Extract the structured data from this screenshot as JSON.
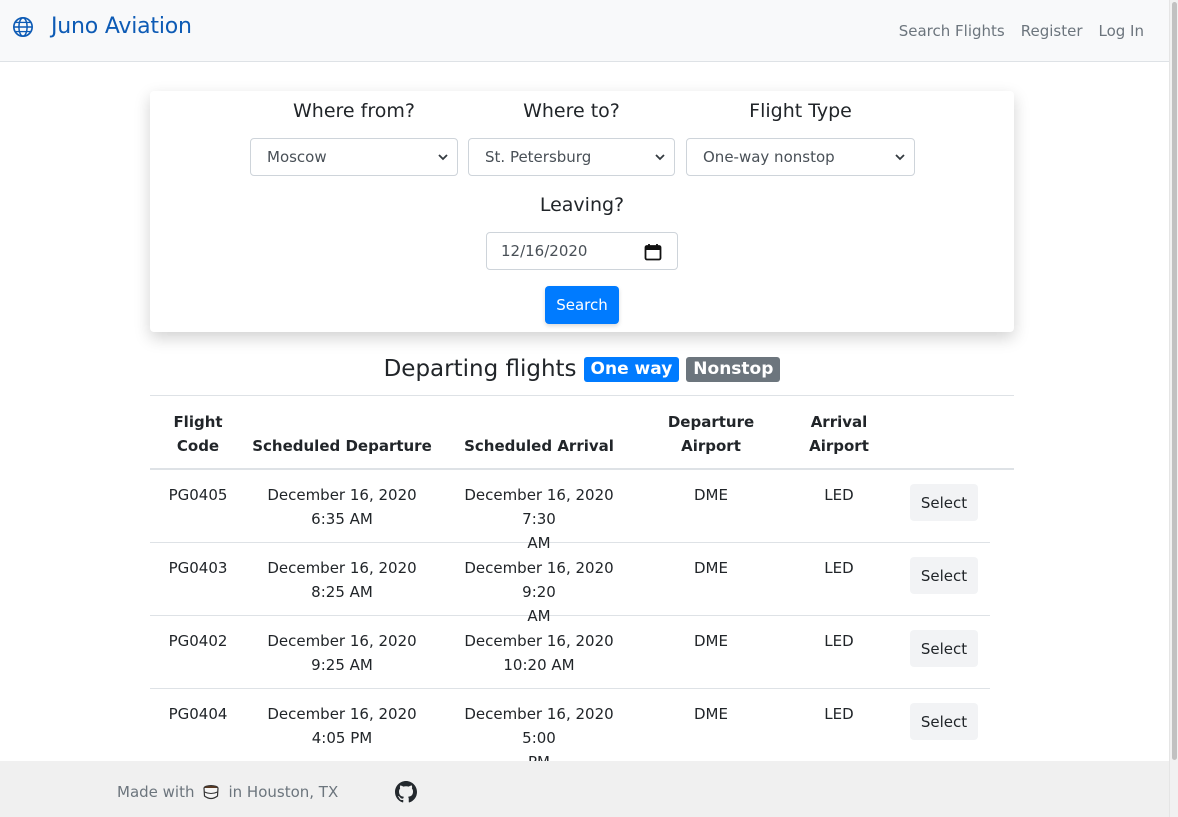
{
  "navbar": {
    "brand": "Juno Aviation",
    "links": [
      "Search Flights",
      "Register",
      "Log In"
    ]
  },
  "search": {
    "from_label": "Where from?",
    "from_value": "Moscow",
    "to_label": "Where to?",
    "to_value": "St. Petersburg",
    "type_label": "Flight Type",
    "type_value": "One-way nonstop",
    "leaving_label": "Leaving?",
    "leaving_value": "12/16/2020",
    "button": "Search"
  },
  "results": {
    "title": "Departing flights",
    "badges": [
      "One way",
      "Nonstop"
    ],
    "columns": {
      "code": [
        "Flight",
        "Code"
      ],
      "departure": "Scheduled Departure",
      "arrival": "Scheduled Arrival",
      "dep_airport": [
        "Departure",
        "Airport"
      ],
      "arr_airport": [
        "Arrival",
        "Airport"
      ]
    },
    "select_label": "Select",
    "rows": [
      {
        "code": "PG0405",
        "departure": [
          "December 16, 2020",
          "6:35 AM"
        ],
        "arrival": [
          "December 16, 2020 7:30",
          "AM"
        ],
        "from": "DME",
        "to": "LED"
      },
      {
        "code": "PG0403",
        "departure": [
          "December 16, 2020",
          "8:25 AM"
        ],
        "arrival": [
          "December 16, 2020 9:20",
          "AM"
        ],
        "from": "DME",
        "to": "LED"
      },
      {
        "code": "PG0402",
        "departure": [
          "December 16, 2020",
          "9:25 AM"
        ],
        "arrival": [
          "December 16, 2020",
          "10:20 AM"
        ],
        "from": "DME",
        "to": "LED"
      },
      {
        "code": "PG0404",
        "departure": [
          "December 16, 2020",
          "4:05 PM"
        ],
        "arrival": [
          "December 16, 2020 5:00",
          "PM"
        ],
        "from": "DME",
        "to": "LED"
      }
    ]
  },
  "footer": {
    "made_with": "Made with",
    "location": "in Houston, TX"
  },
  "icons": {
    "brand": "globe-icon",
    "footer_love": "coffee-icon",
    "footer_link": "github-icon",
    "date": "calendar-icon",
    "select": "chevron-down-icon"
  },
  "colors": {
    "brand": "#0d5bb5",
    "primary": "#007bff",
    "secondary": "#6c757d"
  }
}
